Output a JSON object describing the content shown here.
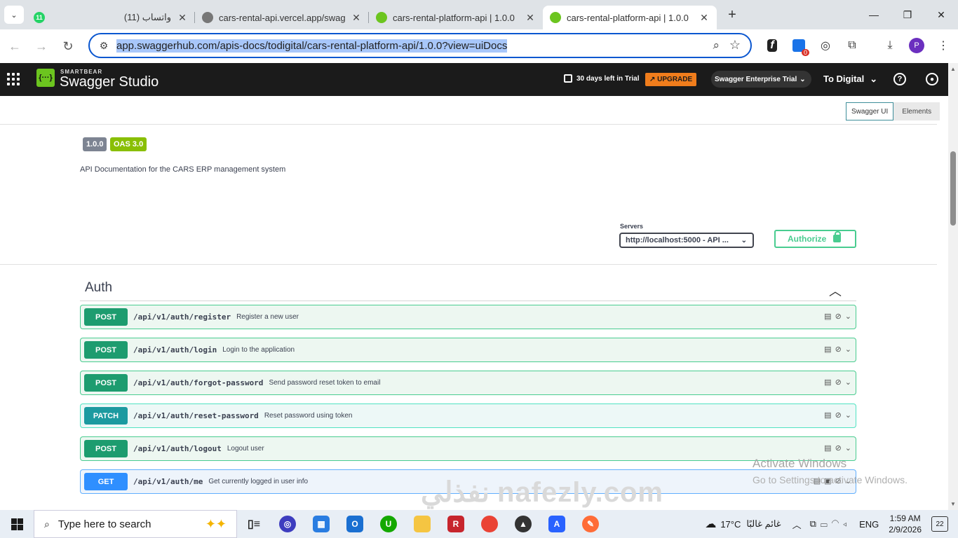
{
  "browser": {
    "tabs": [
      {
        "title": "واتساب (11)",
        "badge": "11",
        "active": false
      },
      {
        "title": "cars-rental-api.vercel.app/swag",
        "active": false
      },
      {
        "title": "cars-rental-platform-api | 1.0.0",
        "active": false
      },
      {
        "title": "cars-rental-platform-api | 1.0.0",
        "active": true
      }
    ],
    "url": "app.swaggerhub.com/apis-docs/todigital/cars-rental-platform-api/1.0.0?view=uiDocs",
    "profile_initial": "P",
    "ext_badge": "0"
  },
  "header": {
    "brand_small": "SMARTBEAR",
    "brand": "Swagger Studio",
    "trial_text": "30 days left in Trial",
    "upgrade_label": "↗ UPGRADE",
    "enterprise_label": "Swagger Enterprise Trial",
    "org_label": "To Digital"
  },
  "view_switch": {
    "swagger_ui": "Swagger UI",
    "elements": "Elements"
  },
  "info": {
    "version": "1.0.0",
    "oas": "OAS 3.0",
    "description": "API Documentation for the CARS ERP management system"
  },
  "servers": {
    "label": "Servers",
    "selected": "http://localhost:5000 - API ..."
  },
  "authorize_label": "Authorize",
  "section": {
    "title": "Auth",
    "operations": [
      {
        "method": "POST",
        "path": "/api/v1/auth/register",
        "summary": "Register a new user"
      },
      {
        "method": "POST",
        "path": "/api/v1/auth/login",
        "summary": "Login to the application"
      },
      {
        "method": "POST",
        "path": "/api/v1/auth/forgot-password",
        "summary": "Send password reset token to email"
      },
      {
        "method": "PATCH",
        "path": "/api/v1/auth/reset-password",
        "summary": "Reset password using token"
      },
      {
        "method": "POST",
        "path": "/api/v1/auth/logout",
        "summary": "Logout user"
      },
      {
        "method": "GET",
        "path": "/api/v1/auth/me",
        "summary": "Get currently logged in user info"
      }
    ]
  },
  "watermark": {
    "line1": "Activate Windows",
    "line2": "Go to Settings to activate Windows.",
    "site": "نفذلي nafezly.com"
  },
  "taskbar": {
    "search_placeholder": "Type here to search",
    "weather": "17°C",
    "weather_desc": "غائم غالبًا",
    "lang": "ENG",
    "time": "1:59 AM",
    "date": "2/9/2026",
    "notifications": "22"
  }
}
